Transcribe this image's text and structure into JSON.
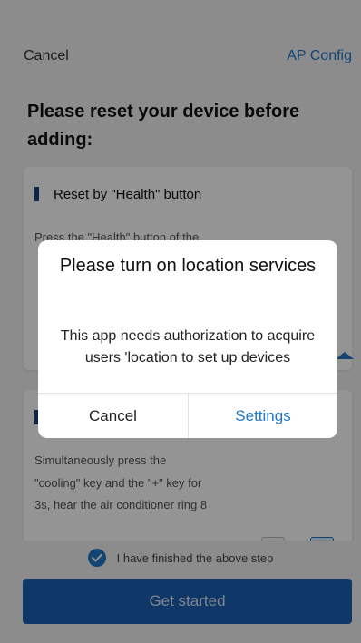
{
  "header": {
    "cancel_label": "Cancel",
    "ap_config_label": "AP Config"
  },
  "page": {
    "title": "Please reset your device before adding:"
  },
  "cards": [
    {
      "title": "Reset by \"Health\" button",
      "body": "Press the \"Health\" button of the"
    },
    {
      "title": "",
      "body_lines": [
        "Simultaneously press the",
        "\"cooling\" key and the \"+\" key for",
        "3s, hear the air conditioner ring 8"
      ]
    }
  ],
  "footer": {
    "confirm_label": "I have finished the above step",
    "start_label": "Get started"
  },
  "dialog": {
    "title": "Please turn on location services",
    "message": "This app needs authorization to acquire users 'location to set up devices",
    "cancel_label": "Cancel",
    "settings_label": "Settings"
  },
  "colors": {
    "accent": "#1f77c6",
    "primary_button": "#1a5fb4",
    "card_marker": "#1a3f7e"
  }
}
